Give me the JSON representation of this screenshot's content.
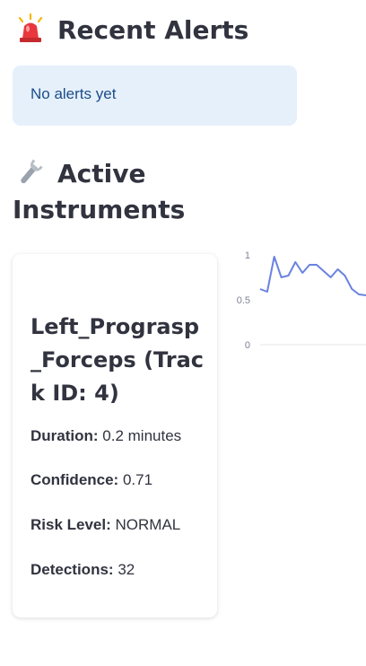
{
  "alerts": {
    "heading": "Recent Alerts",
    "icon": "siren-icon",
    "empty_message": "No alerts yet"
  },
  "instruments": {
    "heading": "Active Instruments",
    "icon": "wrench-icon",
    "cards": [
      {
        "title": "Left_Prograsp_Forceps (Track ID: 4)",
        "duration_label": "Duration:",
        "duration_value": "0.2 minutes",
        "confidence_label": "Confidence:",
        "confidence_value": "0.71",
        "risk_label": "Risk Level:",
        "risk_value": "NORMAL",
        "detections_label": "Detections:",
        "detections_value": "32"
      }
    ]
  },
  "colors": {
    "alert_bg": "#e6f0fb",
    "alert_text": "#1b4d89",
    "line": "#6a82e0"
  },
  "chart_data": {
    "type": "line",
    "ytick_labels": [
      "1",
      "0.5",
      "0"
    ],
    "ylim": [
      0,
      1
    ],
    "series": [
      {
        "values": [
          0.62,
          0.59,
          0.98,
          0.75,
          0.77,
          0.92,
          0.8,
          0.89,
          0.89,
          0.82,
          0.75,
          0.84,
          0.77,
          0.62,
          0.56,
          0.55
        ]
      }
    ]
  }
}
